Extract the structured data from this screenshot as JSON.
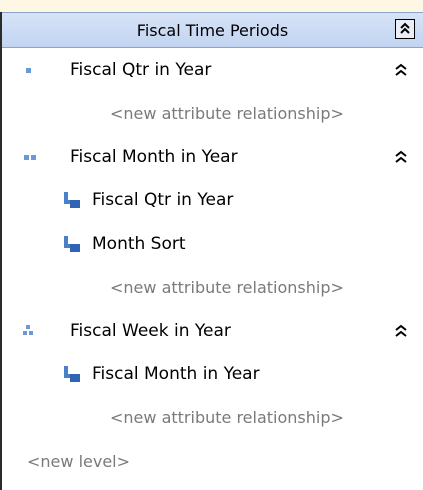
{
  "hierarchy": {
    "title": "Fiscal Time Periods",
    "collapse_icon": "collapse-all-icon"
  },
  "rows": [
    {
      "kind": "level",
      "label": "Fiscal Qtr in Year",
      "icon": "level-1-dots-icon"
    },
    {
      "kind": "newrel",
      "label": "<new attribute relationship>"
    },
    {
      "kind": "level",
      "label": "Fiscal Month in Year",
      "icon": "level-2-dots-icon"
    },
    {
      "kind": "rel",
      "label": "Fiscal Qtr in Year",
      "icon": "attribute-relationship-icon"
    },
    {
      "kind": "rel",
      "label": "Month Sort",
      "icon": "attribute-relationship-icon"
    },
    {
      "kind": "newrel",
      "label": "<new attribute relationship>"
    },
    {
      "kind": "level",
      "label": "Fiscal Week in Year",
      "icon": "level-3-dots-icon"
    },
    {
      "kind": "rel",
      "label": "Fiscal Month in Year",
      "icon": "attribute-relationship-icon"
    },
    {
      "kind": "newrel",
      "label": "<new attribute relationship>"
    },
    {
      "kind": "newlevel",
      "label": "<new level>"
    }
  ],
  "colors": {
    "header_bg": "#c9d8f3",
    "icon_blue": "#4a7fc9",
    "placeholder_text": "#7a7a7a"
  }
}
